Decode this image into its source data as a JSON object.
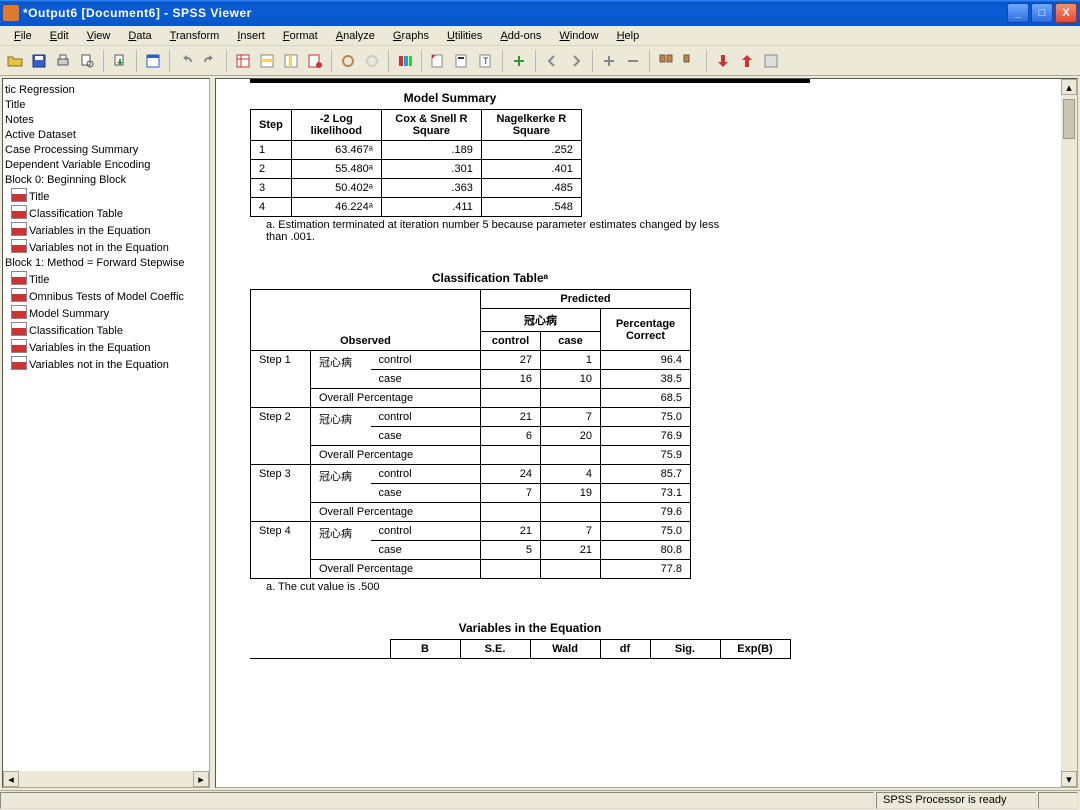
{
  "window": {
    "title": "*Output6 [Document6] - SPSS Viewer",
    "min": "_",
    "max": "□",
    "close": "X"
  },
  "menus": [
    "File",
    "Edit",
    "View",
    "Data",
    "Transform",
    "Insert",
    "Format",
    "Analyze",
    "Graphs",
    "Utilities",
    "Add-ons",
    "Window",
    "Help"
  ],
  "outline": {
    "items": [
      {
        "label": "tic Regression",
        "icn": false
      },
      {
        "label": "Title",
        "icn": false
      },
      {
        "label": "Notes",
        "icn": false
      },
      {
        "label": "Active Dataset",
        "icn": false
      },
      {
        "label": "Case Processing Summary",
        "icn": false
      },
      {
        "label": "Dependent Variable Encoding",
        "icn": false
      },
      {
        "label": "Block 0: Beginning Block",
        "icn": false
      },
      {
        "label": "Title",
        "icn": true
      },
      {
        "label": "Classification Table",
        "icn": true
      },
      {
        "label": "Variables in the Equation",
        "icn": true
      },
      {
        "label": "Variables not in the Equation",
        "icn": true
      },
      {
        "label": "Block 1: Method = Forward Stepwise",
        "icn": false
      },
      {
        "label": "Title",
        "icn": true
      },
      {
        "label": "Omnibus Tests of Model Coeffic",
        "icn": true
      },
      {
        "label": "Model Summary",
        "icn": true
      },
      {
        "label": "Classification Table",
        "icn": true
      },
      {
        "label": "Variables in the Equation",
        "icn": true
      },
      {
        "label": "Variables not in the Equation",
        "icn": true
      }
    ]
  },
  "modelSummary": {
    "title": "Model Summary",
    "headers": [
      "Step",
      "-2 Log likelihood",
      "Cox & Snell R Square",
      "Nagelkerke R Square"
    ],
    "rows": [
      {
        "step": "1",
        "ll": "63.467ᵃ",
        "cox": ".189",
        "nag": ".252"
      },
      {
        "step": "2",
        "ll": "55.480ᵃ",
        "cox": ".301",
        "nag": ".401"
      },
      {
        "step": "3",
        "ll": "50.402ᵃ",
        "cox": ".363",
        "nag": ".485"
      },
      {
        "step": "4",
        "ll": "46.224ᵃ",
        "cox": ".411",
        "nag": ".548"
      }
    ],
    "footnote": "a. Estimation terminated at iteration number 5 because parameter estimates changed by less than .001."
  },
  "classTable": {
    "title": "Classification Tableᵃ",
    "predicted": "Predicted",
    "group": "冠心病",
    "obs": "Observed",
    "cols": [
      "control",
      "case",
      "Percentage Correct"
    ],
    "overall": "Overall Percentage",
    "steps": [
      {
        "step": "Step 1",
        "rows": [
          [
            "control",
            "27",
            "1",
            "96.4"
          ],
          [
            "case",
            "16",
            "10",
            "38.5"
          ]
        ],
        "overall": "68.5"
      },
      {
        "step": "Step 2",
        "rows": [
          [
            "control",
            "21",
            "7",
            "75.0"
          ],
          [
            "case",
            "6",
            "20",
            "76.9"
          ]
        ],
        "overall": "75.9"
      },
      {
        "step": "Step 3",
        "rows": [
          [
            "control",
            "24",
            "4",
            "85.7"
          ],
          [
            "case",
            "7",
            "19",
            "73.1"
          ]
        ],
        "overall": "79.6"
      },
      {
        "step": "Step 4",
        "rows": [
          [
            "control",
            "21",
            "7",
            "75.0"
          ],
          [
            "case",
            "5",
            "21",
            "80.8"
          ]
        ],
        "overall": "77.8"
      }
    ],
    "footnote": "a. The cut value is .500"
  },
  "variablesEq": {
    "title": "Variables in the Equation",
    "headers": [
      "B",
      "S.E.",
      "Wald",
      "df",
      "Sig.",
      "Exp(B)"
    ]
  },
  "status": {
    "ready": "SPSS Processor is ready"
  }
}
